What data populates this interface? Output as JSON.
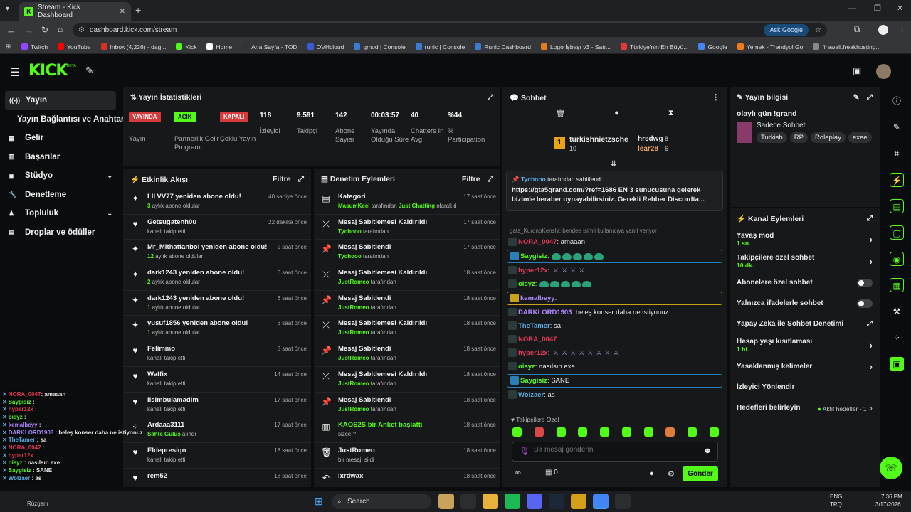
{
  "browser": {
    "tab_title": "Stream - Kick Dashboard",
    "url": "dashboard.kick.com/stream",
    "ask_google": "Ask Google",
    "bookmarks": [
      "Twitch",
      "YouTube",
      "Inbox (4,226) - dag...",
      "Kick",
      "Home",
      "Ana Sayfa - TOD",
      "OVHcloud",
      "gmod | Console",
      "runic | Console",
      "Runic Dashboard",
      "Logo İşbaşı v3 - Satı...",
      "Türkiye'nin En Büyü...",
      "Google",
      "Yemek - Trendyol Go",
      "firewall.freakhosting..."
    ]
  },
  "kick": {
    "beta": "BETA"
  },
  "sidebar": {
    "items": [
      {
        "label": "Yayın",
        "icon": "broadcast-icon"
      },
      {
        "label": "Yayın Bağlantısı ve Anahtarı",
        "icon": ""
      },
      {
        "label": "Gelir",
        "icon": "money-icon"
      },
      {
        "label": "Başarılar",
        "icon": "trophy-icon"
      },
      {
        "label": "Stüdyo",
        "icon": "studio-icon"
      },
      {
        "label": "Denetleme",
        "icon": "wrench-icon"
      },
      {
        "label": "Topluluk",
        "icon": "people-icon"
      },
      {
        "label": "Droplar ve ödüller",
        "icon": "gift-icon"
      }
    ]
  },
  "stats": {
    "title": "Yayın İstatistikleri",
    "items": [
      {
        "value": "YAYINDA",
        "label": "Yayın",
        "color": "#d63a3a"
      },
      {
        "value": "AÇIK",
        "label": "Partnerlik Gelir Programı",
        "color": "#53fc18"
      },
      {
        "value": "KAPALI",
        "label": "Çoklu Yayın",
        "color": "#d63a3a"
      },
      {
        "value": "118",
        "label": "İzleyici"
      },
      {
        "value": "9.591",
        "label": "Takipçi"
      },
      {
        "value": "142",
        "label": "Abone Sayısı"
      },
      {
        "value": "00:03:57",
        "label": "Yayında Olduğu Süre"
      },
      {
        "value": "40",
        "label": "Chatters In Avg."
      },
      {
        "value": "%44",
        "label": "% Participation"
      }
    ]
  },
  "activity": {
    "title": "Etkinlik Akışı",
    "filter": "Filtre",
    "rows": [
      {
        "t": "LILVV77 yeniden abone oldu!",
        "s1": "3",
        "s2": " aylık abone oldular",
        "time": "40 saniye önce",
        "icon": "sparkle-icon"
      },
      {
        "t": "Getsugatenh0u",
        "s2": "kanalı takip etti",
        "time": "22 dakika önce",
        "icon": "heart-icon"
      },
      {
        "t": "Mr_Mithatfanboi yeniden abone oldu!",
        "s1": "12",
        "s2": " aylık abone oldular",
        "time": "2 saat önce",
        "icon": "sparkle-icon"
      },
      {
        "t": "dark1243 yeniden abone oldu!",
        "s1": "2",
        "s2": " aylık abone oldular",
        "time": "6 saat önce",
        "icon": "sparkle-icon"
      },
      {
        "t": "dark1243 yeniden abone oldu!",
        "s1": "1",
        "s2": " aylık abone oldular",
        "time": "6 saat önce",
        "icon": "sparkle-icon"
      },
      {
        "t": "yusuf1856 yeniden abone oldu!",
        "s1": "1",
        "s2": " aylık abone oldular",
        "time": "6 saat önce",
        "icon": "sparkle-icon"
      },
      {
        "t": "Felimmo",
        "s2": "kanalı takip etti",
        "time": "8 saat önce",
        "icon": "heart-icon"
      },
      {
        "t": "Waffix",
        "s2": "kanalı takip etti",
        "time": "14 saat önce",
        "icon": "heart-icon"
      },
      {
        "t": "iisimbulamadim",
        "s2": "kanalı takip etti",
        "time": "17 saat önce",
        "icon": "heart-icon"
      },
      {
        "t": "Ardaaa3111",
        "s1": "Sahte Gülüş",
        "s2": " alındı",
        "time": "17 saat önce",
        "icon": "dots-icon"
      },
      {
        "t": "Eldepresiqn",
        "s2": "kanalı takip etti",
        "time": "18 saat önce",
        "icon": "heart-icon"
      },
      {
        "t": "rem52",
        "s2": "",
        "time": "18 saat önce",
        "icon": "heart-icon"
      }
    ]
  },
  "mod": {
    "title": "Denetim Eylemleri",
    "filter": "Filtre",
    "rows": [
      {
        "t": "Kategori",
        "s1": "MasumKeci",
        "s2": " tarafından ",
        "s3": "Just Chatting",
        "s4": " olarak değiştirildi",
        "time": "17 saat önce",
        "icon": "category-icon"
      },
      {
        "t": "Mesaj Sabitlemesi Kaldırıldı",
        "s1": "Tychooo",
        "s2": " tarafından",
        "time": "17 saat önce",
        "icon": "unpin-icon"
      },
      {
        "t": "Mesaj Sabitlendi",
        "s1": "Tychooo",
        "s2": " tarafından",
        "time": "17 saat önce",
        "icon": "pin-icon"
      },
      {
        "t": "Mesaj Sabitlemesi Kaldırıldı",
        "s1": "JustRomeo",
        "s2": " tarafından",
        "time": "18 saat önce",
        "icon": "unpin-icon"
      },
      {
        "t": "Mesaj Sabitlendi",
        "s1": "JustRomeo",
        "s2": " tarafından",
        "time": "18 saat önce",
        "icon": "pin-icon"
      },
      {
        "t": "Mesaj Sabitlemesi Kaldırıldı",
        "s1": "JustRomeo",
        "s2": " tarafından",
        "time": "18 saat önce",
        "icon": "unpin-icon"
      },
      {
        "t": "Mesaj Sabitlendi",
        "s1": "JustRomeo",
        "s2": " tarafından",
        "time": "18 saat önce",
        "icon": "pin-icon"
      },
      {
        "t": "Mesaj Sabitlemesi Kaldırıldı",
        "s1": "JustRomeo",
        "s2": " tarafından",
        "time": "18 saat önce",
        "icon": "unpin-icon"
      },
      {
        "t": "Mesaj Sabitlendi",
        "s1": "JustRomeo",
        "s2": " tarafından",
        "time": "18 saat önce",
        "icon": "pin-icon"
      },
      {
        "t": "KAOS2S bir Anket başlattı",
        "s2": "sizce ?",
        "time": "18 saat önce",
        "icon": "poll-icon",
        "green": true
      },
      {
        "t": "JustRomeo",
        "s2": "bir mesajı sildi",
        "time": "18 saat önce",
        "icon": "trash-icon"
      },
      {
        "t": "lxrdwax",
        "s2": "",
        "time": "18 saat önce",
        "icon": "undo-icon"
      }
    ]
  },
  "chat": {
    "title": "Sohbet",
    "top1": "turkishnietzsche",
    "top1_count": "10",
    "top2": "hrsdwg",
    "top2_count": "8",
    "top3": "lear28",
    "top3_count": "6",
    "pinned_by": "Tychooo",
    "pinned_suffix": " tarafından sabitlendi",
    "pinned_link": "https://gta5grand.com/?ref=1686",
    "pinned_text": " EN 3 sunucusuna gelerek bizimle beraber oynayabilirsiniz. Gerekli Rehber Discordta...",
    "reply1": "gats_KuronoKenshi: bendee isimli kullanıcıya yanıt veriyor",
    "messages": [
      {
        "user": "NORA_0047",
        "color": "#e33a57",
        "text": "amaaan"
      },
      {
        "user": "Saygisiz",
        "color": "#53fc18",
        "emotes": 5,
        "box": "#2a7fb8"
      },
      {
        "user": "hyper12x",
        "color": "#e33a57",
        "swords": 4
      },
      {
        "user": "oisyz",
        "color": "#53fc18",
        "emotes": 5
      },
      {
        "user": "kemalbeyy",
        "color": "#b089ff",
        "box": "#c8a21a"
      },
      {
        "user": "DARKLORD1903",
        "color": "#b089ff",
        "text": "beleş konser daha ne istiyonuz"
      },
      {
        "user": "TheTamer",
        "color": "#5dade2",
        "text": "sa"
      },
      {
        "user": "NORA_0047",
        "color": "#e33a57",
        "text": ""
      },
      {
        "user": "hyper12x",
        "color": "#e33a57",
        "swords": 8
      },
      {
        "user": "oisyz",
        "color": "#53fc18",
        "text": "nasılsın exe"
      },
      {
        "user": "Saygisiz",
        "color": "#53fc18",
        "text": "SANE",
        "box": "#2a7fb8"
      },
      {
        "user": "Wolzaer",
        "color": "#5dade2",
        "text": "as"
      }
    ],
    "followers_only": "Takipçilere Özel",
    "input_placeholder": "Bir mesaj gönderin",
    "points": "0",
    "send": "Gönder"
  },
  "info": {
    "title": "Yayın bilgisi",
    "stream_title": "olaylı gün !grand",
    "category": "Sadece Sohbet",
    "tags": [
      "Turkish",
      "RP",
      "Roleplay",
      "exee"
    ]
  },
  "actions": {
    "title": "Kanal Eylemleri",
    "items": [
      {
        "label": "Yavaş mod",
        "sub": "1 sn.",
        "kind": "chevron"
      },
      {
        "label": "Takipçilere özel sohbet",
        "sub": "10 dk.",
        "kind": "chevron"
      },
      {
        "label": "Abonelere özel sohbet",
        "sub": "",
        "kind": "toggle"
      },
      {
        "label": "Yalnızca ifadelerle sohbet",
        "sub": "",
        "kind": "toggle"
      },
      {
        "label": "Yapay Zeka ile Sohbet Denetimi",
        "sub": "",
        "kind": "ext"
      },
      {
        "label": "Hesap yaşı kısıtlaması",
        "sub": "1 hf.",
        "kind": "chevron"
      },
      {
        "label": "Yasaklanmış kelimeler",
        "sub": "",
        "kind": "chevron"
      },
      {
        "label": "İzleyici Yönlendir",
        "sub": "",
        "kind": "none"
      },
      {
        "label": "Hedefleri belirleyin",
        "sub": "",
        "kind": "goal"
      }
    ],
    "goal_status": "Aktif hedefler - 1"
  },
  "overlay": [
    {
      "user": "NORA_0047",
      "color": "#e33a57",
      "text": ": amaaan"
    },
    {
      "user": "Saygisiz",
      "color": "#53fc18",
      "text": " :"
    },
    {
      "user": "hyper12x",
      "color": "#e33a57",
      "text": " :"
    },
    {
      "user": "oisyz",
      "color": "#53fc18",
      "text": " :"
    },
    {
      "user": "kemalbeyy",
      "color": "#b089ff",
      "text": " :"
    },
    {
      "user": "DARKLORD1903",
      "color": "#b089ff",
      "text": " : beleş konser daha ne istiyonuz"
    },
    {
      "user": "TheTamer",
      "color": "#5dade2",
      "text": " : sa"
    },
    {
      "user": "NORA_0047",
      "color": "#e33a57",
      "text": " :"
    },
    {
      "user": "hyper12x",
      "color": "#e33a57",
      "text": " :"
    },
    {
      "user": "oisyz",
      "color": "#53fc18",
      "text": " : nasılsın exe"
    },
    {
      "user": "Saygisiz",
      "color": "#53fc18",
      "text": " : SANE"
    },
    {
      "user": "Wolzaer",
      "color": "#5dade2",
      "text": " : as"
    }
  ],
  "taskbar": {
    "search": "Search",
    "lang1": "ENG",
    "lang2": "TRQ",
    "time": "7:36 PM",
    "date": "3/17/2026",
    "weather": "Rüzgarlı"
  }
}
